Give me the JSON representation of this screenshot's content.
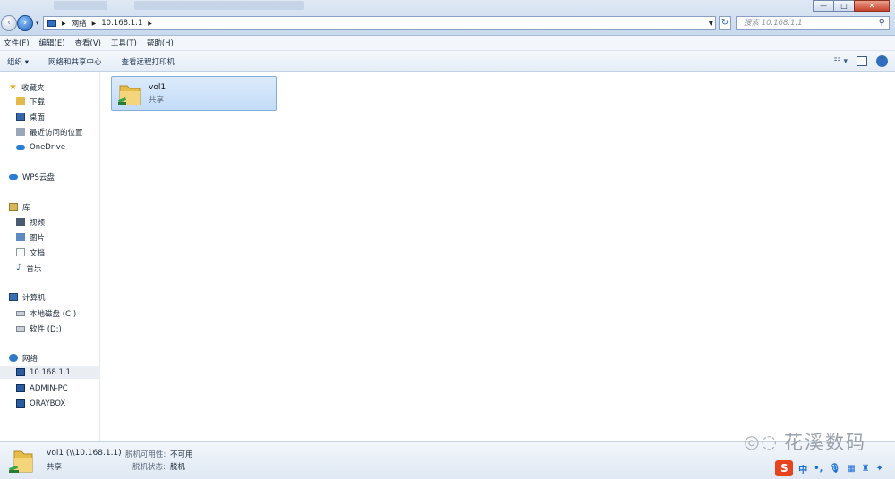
{
  "window": {
    "controls": {
      "minimize": "—",
      "maximize": "□",
      "close": "✕"
    }
  },
  "navigation": {
    "back_icon": "back-arrow-icon",
    "forward_icon": "forward-arrow-icon"
  },
  "address": {
    "segments": [
      "网络",
      "10.168.1.1"
    ],
    "search_placeholder": "搜索 10.168.1.1"
  },
  "menubar": {
    "items": [
      "文件(F)",
      "编辑(E)",
      "查看(V)",
      "工具(T)",
      "帮助(H)"
    ]
  },
  "commands": {
    "organize": "组织 ▾",
    "network_center": "网络和共享中心",
    "remote_printers": "查看远程打印机"
  },
  "sidebar": {
    "favorites": "收藏夹",
    "downloads": "下载",
    "desktop": "桌面",
    "recent": "最近访问的位置",
    "onedrive": "OneDrive",
    "wps": "WPS云盘",
    "libraries": "库",
    "videos": "视频",
    "pictures": "图片",
    "documents": "文档",
    "music": "音乐",
    "computer": "计算机",
    "drive_c": "本地磁盘 (C:)",
    "drive_d": "软件 (D:)",
    "network": "网络",
    "host_selected": "10.168.1.1",
    "host_admin": "ADMIN-PC",
    "host_oray": "ORAYBOX"
  },
  "content": {
    "share_name": "vol1",
    "share_type": "共享"
  },
  "details": {
    "name": "vol1 (\\\\10.168.1.1)",
    "type": "共享",
    "offline_avail_label": "脱机可用性:",
    "offline_avail_value": "不可用",
    "offline_status_label": "脱机状态:",
    "offline_status_value": "脱机"
  },
  "watermark": "花溪数码",
  "ime": {
    "logo": "S",
    "lang": "中"
  },
  "colors": {
    "selection": "#c3dcf7",
    "accent": "#2f6fc2",
    "ime": "#e8431f"
  }
}
